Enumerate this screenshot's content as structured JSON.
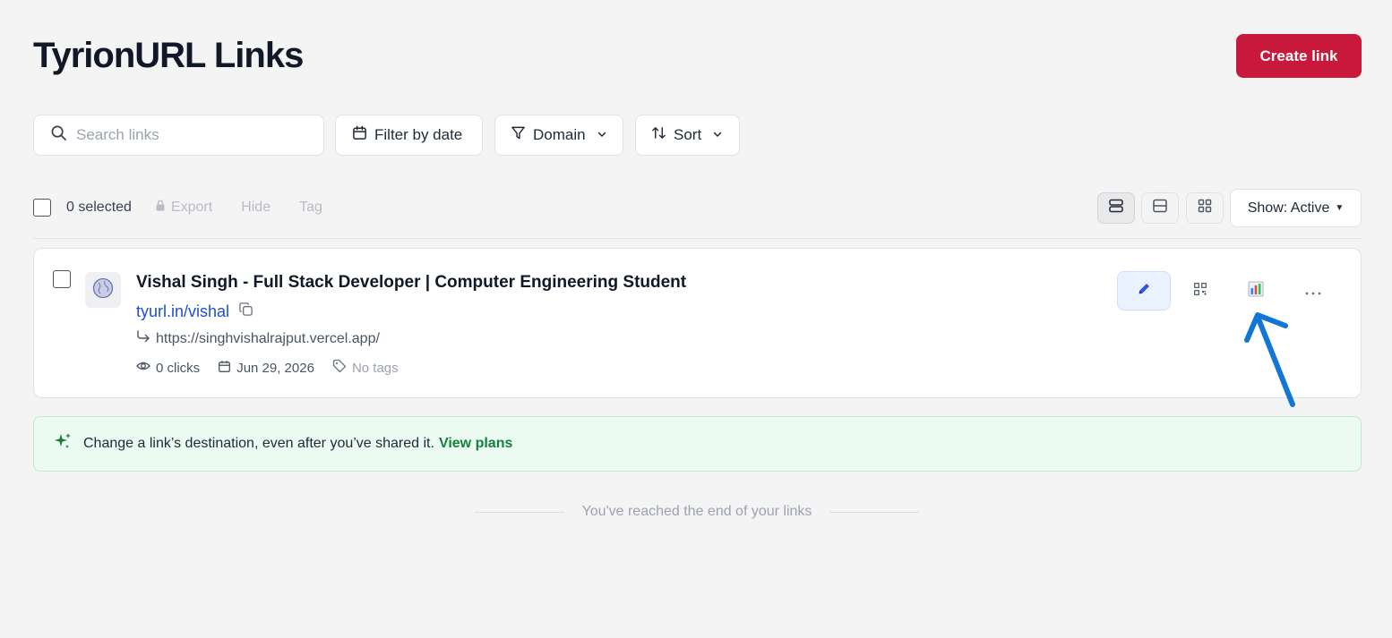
{
  "header": {
    "title": "TyrionURL Links",
    "create_label": "Create link"
  },
  "toolbar": {
    "search_placeholder": "Search links",
    "filter_label": "Filter by date",
    "domain_label": "Domain",
    "sort_label": "Sort"
  },
  "bulk": {
    "selected_label": "0 selected",
    "export_label": "Export",
    "hide_label": "Hide",
    "tag_label": "Tag"
  },
  "view": {
    "show_label": "Show: Active"
  },
  "links": [
    {
      "title": "Vishal Singh - Full Stack Developer | Computer Engineering Student",
      "short_url": "tyurl.in/vishal",
      "destination": "https://singhvishalrajput.vercel.app/",
      "clicks": "0 clicks",
      "date": "Jun 29, 2026",
      "tags": "No tags"
    }
  ],
  "upsell": {
    "text": "Change a link’s destination, even after you’ve shared it.",
    "link": "View plans"
  },
  "footer": {
    "end_text": "You've reached the end of your links"
  },
  "colors": {
    "brand": "#c8193c",
    "link": "#1d4ed8",
    "upsell_link": "#15803d",
    "annotation": "#1176d6"
  }
}
